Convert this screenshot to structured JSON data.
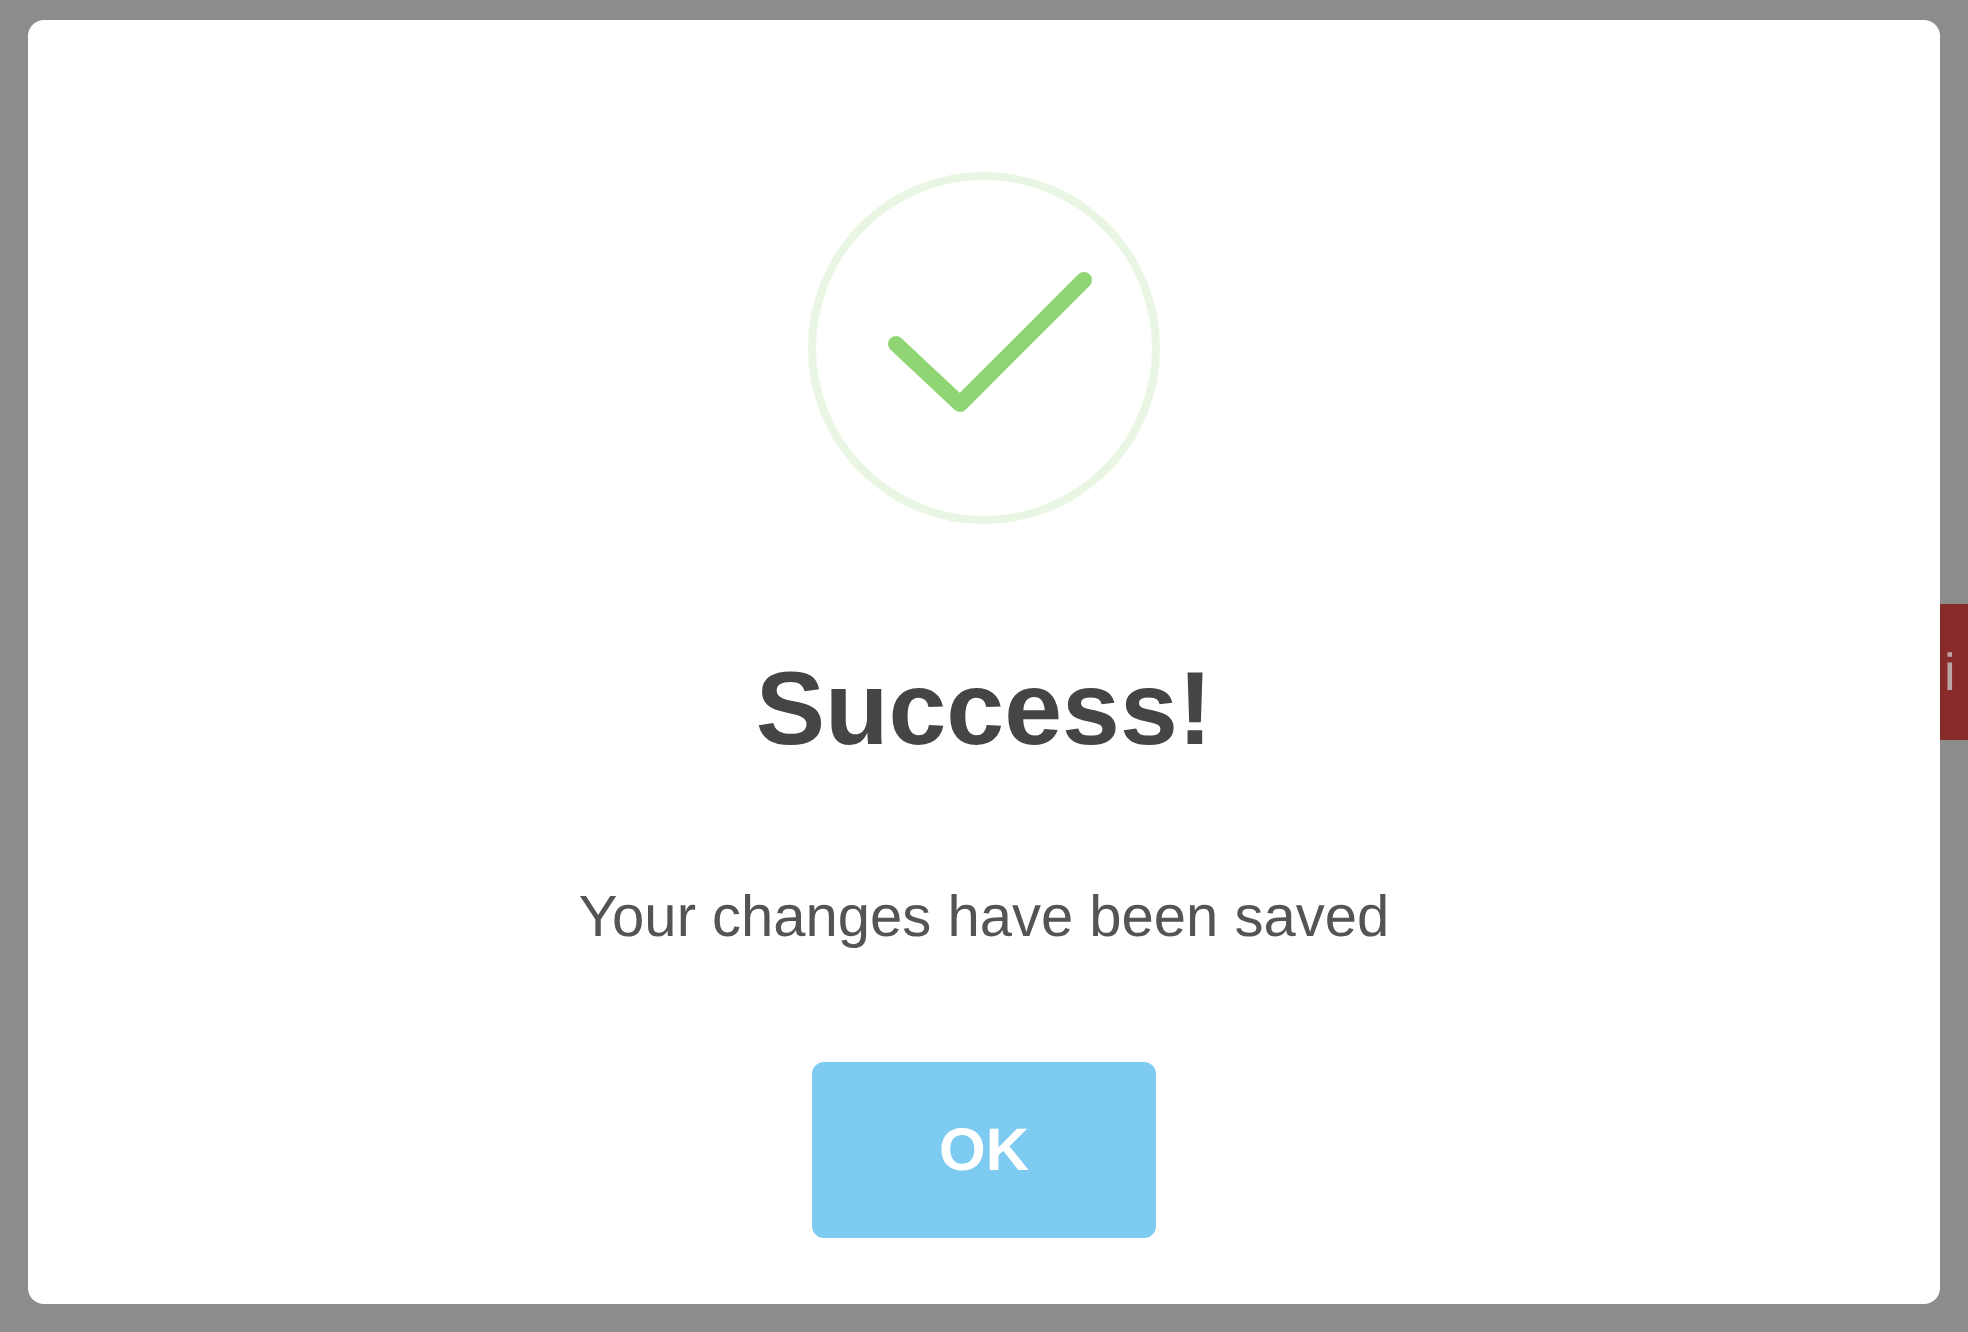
{
  "background": {
    "button": "i"
  },
  "dialog": {
    "title": "Success!",
    "message": "Your changes have been saved",
    "button": "OK"
  }
}
